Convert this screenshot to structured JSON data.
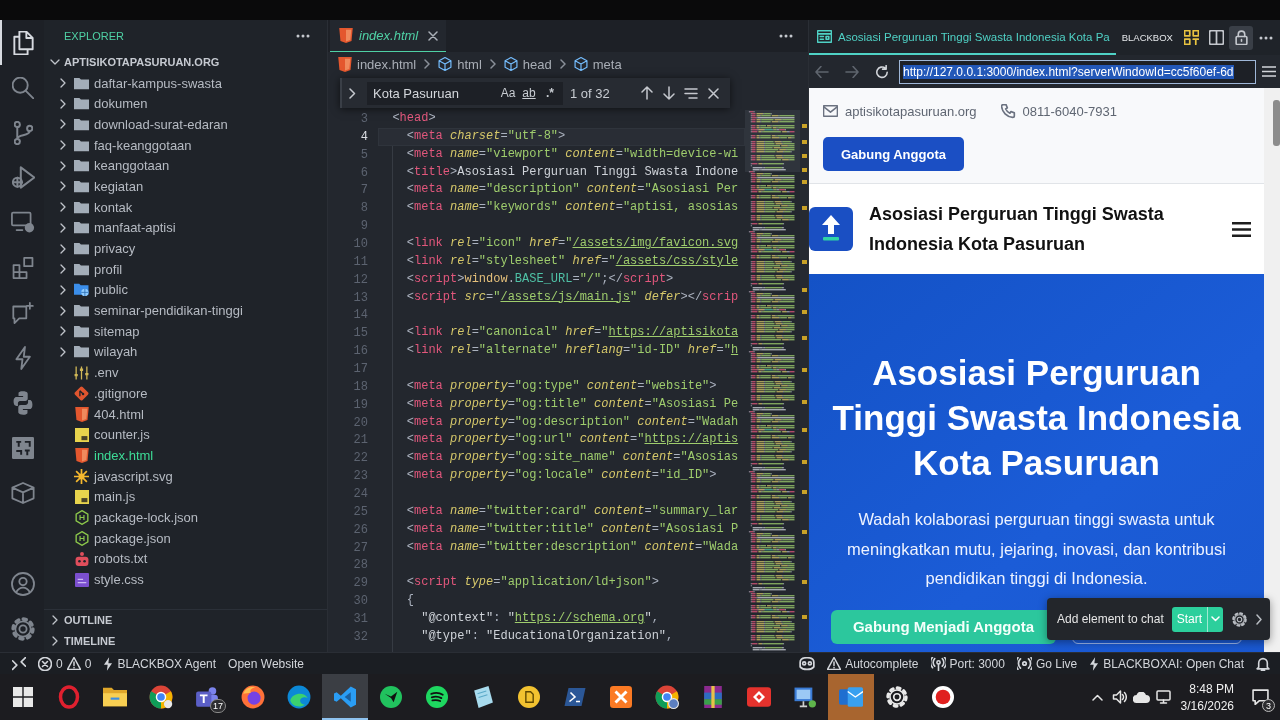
{
  "activity_bar": {
    "items": [
      {
        "kind": "explorer",
        "selected": true
      },
      {
        "kind": "search",
        "selected": false
      },
      {
        "kind": "source-control",
        "selected": false
      },
      {
        "kind": "run-debug",
        "selected": false
      },
      {
        "kind": "remote-explorer",
        "selected": false
      },
      {
        "kind": "extensions",
        "selected": false
      },
      {
        "kind": "chat",
        "selected": false
      },
      {
        "kind": "agent",
        "selected": false
      },
      {
        "kind": "python",
        "selected": false
      },
      {
        "kind": "tile",
        "selected": false
      },
      {
        "kind": "containers",
        "selected": false
      }
    ],
    "bottom": [
      {
        "kind": "accounts"
      },
      {
        "kind": "manage"
      }
    ]
  },
  "sidebar": {
    "title": "EXPLORER",
    "tree": {
      "label": "APTISIKOTAPASURUAN.ORG",
      "expanded": true,
      "children": [
        {
          "label": "daftar-kampus-swasta",
          "kind": "folder",
          "expanded": false,
          "selected": false
        },
        {
          "label": "dokumen",
          "kind": "folder",
          "expanded": false,
          "selected": false
        },
        {
          "label": "download-surat-edaran",
          "kind": "folder",
          "expanded": false,
          "selected": false
        },
        {
          "label": "faq-keanggotaan",
          "kind": "folder",
          "expanded": false,
          "selected": false
        },
        {
          "label": "keanggotaan",
          "kind": "folder",
          "expanded": false,
          "selected": false
        },
        {
          "label": "kegiatan",
          "kind": "folder",
          "expanded": false,
          "selected": false
        },
        {
          "label": "kontak",
          "kind": "folder",
          "expanded": false,
          "selected": false
        },
        {
          "label": "manfaat-aptisi",
          "kind": "folder",
          "expanded": false,
          "selected": false
        },
        {
          "label": "privacy",
          "kind": "folder",
          "expanded": false,
          "selected": false
        },
        {
          "label": "profil",
          "kind": "folder",
          "expanded": false,
          "selected": false
        },
        {
          "label": "public",
          "kind": "webfolder",
          "expanded": false,
          "selected": false
        },
        {
          "label": "seminar-pendidikan-tinggi",
          "kind": "folder",
          "expanded": false,
          "selected": false
        },
        {
          "label": "sitemap",
          "kind": "folder",
          "expanded": false,
          "selected": false
        },
        {
          "label": "wilayah",
          "kind": "folder",
          "expanded": false,
          "selected": false
        },
        {
          "label": ".env",
          "kind": "env",
          "selected": false
        },
        {
          "label": ".gitignore",
          "kind": "git",
          "selected": false
        },
        {
          "label": "404.html",
          "kind": "html",
          "selected": false
        },
        {
          "label": "counter.js",
          "kind": "js",
          "selected": false
        },
        {
          "label": "index.html",
          "kind": "html",
          "selected": true
        },
        {
          "label": "javascript.svg",
          "kind": "svg",
          "selected": false
        },
        {
          "label": "main.js",
          "kind": "js",
          "selected": false
        },
        {
          "label": "package-lock.json",
          "kind": "npm",
          "selected": false
        },
        {
          "label": "package.json",
          "kind": "npm",
          "selected": false
        },
        {
          "label": "robots.txt",
          "kind": "robot",
          "selected": false
        },
        {
          "label": "style.css",
          "kind": "css",
          "selected": false
        }
      ]
    },
    "sections": [
      {
        "label": "OUTLINE",
        "expanded": false
      },
      {
        "label": "TIMELINE",
        "expanded": false
      }
    ]
  },
  "editor": {
    "tabs": [
      {
        "label": "index.html",
        "kind": "html",
        "selected": true,
        "preview": true
      }
    ],
    "breadcrumbs": [
      {
        "label": "index.html",
        "kind": "file"
      },
      {
        "label": "html",
        "kind": "element"
      },
      {
        "label": "head",
        "kind": "element"
      },
      {
        "label": "meta",
        "kind": "element"
      }
    ],
    "find": {
      "value": "Kota Pasuruan",
      "options": [
        {
          "label": "Aa",
          "kind": "case"
        },
        {
          "label": "ab",
          "kind": "word"
        },
        {
          "label": ".*",
          "kind": "regex"
        }
      ],
      "result": "1 of 32"
    },
    "lines": [
      {
        "number": "3",
        "current": false,
        "tokens": [
          {
            "kind": "punct",
            "text": "  <"
          },
          {
            "kind": "tag",
            "text": "head"
          },
          {
            "kind": "punct",
            "text": ">"
          }
        ]
      },
      {
        "number": "4",
        "current": true,
        "tokens": [
          {
            "kind": "punct",
            "text": "    <"
          },
          {
            "kind": "tag",
            "text": "meta"
          },
          {
            "kind": "attr",
            "text": " charset"
          },
          {
            "kind": "punct",
            "text": "="
          },
          {
            "kind": "string",
            "text": "\"utf-8\""
          },
          {
            "kind": "punct",
            "text": ">"
          }
        ]
      },
      {
        "number": "5",
        "current": false,
        "tokens": [
          {
            "kind": "punct",
            "text": "    <"
          },
          {
            "kind": "tag",
            "text": "meta"
          },
          {
            "kind": "attr",
            "text": " name"
          },
          {
            "kind": "punct",
            "text": "="
          },
          {
            "kind": "string",
            "text": "\"viewport\""
          },
          {
            "kind": "attr",
            "text": " content"
          },
          {
            "kind": "punct",
            "text": "="
          },
          {
            "kind": "string",
            "text": "\"width=device-wi"
          }
        ]
      },
      {
        "number": "6",
        "current": false,
        "tokens": [
          {
            "kind": "punct",
            "text": "    <"
          },
          {
            "kind": "tag",
            "text": "title"
          },
          {
            "kind": "punct",
            "text": ">"
          },
          {
            "kind": "text",
            "text": "Asosiasi Perguruan Tinggi Swasta Indone"
          }
        ]
      },
      {
        "number": "7",
        "current": false,
        "tokens": [
          {
            "kind": "punct",
            "text": "    <"
          },
          {
            "kind": "tag",
            "text": "meta"
          },
          {
            "kind": "attr",
            "text": " name"
          },
          {
            "kind": "punct",
            "text": "="
          },
          {
            "kind": "string",
            "text": "\"description\""
          },
          {
            "kind": "attr",
            "text": " content"
          },
          {
            "kind": "punct",
            "text": "="
          },
          {
            "kind": "string",
            "text": "\"Asosiasi Per"
          }
        ]
      },
      {
        "number": "8",
        "current": false,
        "tokens": [
          {
            "kind": "punct",
            "text": "    <"
          },
          {
            "kind": "tag",
            "text": "meta"
          },
          {
            "kind": "attr",
            "text": " name"
          },
          {
            "kind": "punct",
            "text": "="
          },
          {
            "kind": "string",
            "text": "\"keywords\""
          },
          {
            "kind": "attr",
            "text": " content"
          },
          {
            "kind": "punct",
            "text": "="
          },
          {
            "kind": "string",
            "text": "\"aptisi, asosias"
          }
        ]
      },
      {
        "number": "9",
        "current": false
      },
      {
        "number": "10",
        "current": false,
        "tokens": [
          {
            "kind": "punct",
            "text": "    <"
          },
          {
            "kind": "tag",
            "text": "link"
          },
          {
            "kind": "attr",
            "text": " rel"
          },
          {
            "kind": "punct",
            "text": "="
          },
          {
            "kind": "string",
            "text": "\"icon\""
          },
          {
            "kind": "attr",
            "text": " href"
          },
          {
            "kind": "punct",
            "text": "="
          },
          {
            "kind": "string",
            "text": "\""
          },
          {
            "kind": "link",
            "text": "/assets/img/favicon.svg"
          }
        ]
      },
      {
        "number": "11",
        "current": false,
        "tokens": [
          {
            "kind": "punct",
            "text": "    <"
          },
          {
            "kind": "tag",
            "text": "link"
          },
          {
            "kind": "attr",
            "text": " rel"
          },
          {
            "kind": "punct",
            "text": "="
          },
          {
            "kind": "string",
            "text": "\"stylesheet\""
          },
          {
            "kind": "attr",
            "text": " href"
          },
          {
            "kind": "punct",
            "text": "="
          },
          {
            "kind": "string",
            "text": "\""
          },
          {
            "kind": "link",
            "text": "/assets/css/style"
          }
        ]
      },
      {
        "number": "12",
        "current": false,
        "tokens": [
          {
            "kind": "punct",
            "text": "    <"
          },
          {
            "kind": "tag",
            "text": "script"
          },
          {
            "kind": "punct",
            "text": ">"
          },
          {
            "kind": "object",
            "text": "window"
          },
          {
            "kind": "punct",
            "text": "."
          },
          {
            "kind": "property",
            "text": "BASE_URL"
          },
          {
            "kind": "punct",
            "text": "="
          },
          {
            "kind": "string",
            "text": "\"/\""
          },
          {
            "kind": "punct",
            "text": ";</"
          },
          {
            "kind": "tag",
            "text": "script"
          },
          {
            "kind": "punct",
            "text": ">"
          }
        ]
      },
      {
        "number": "13",
        "current": false,
        "tokens": [
          {
            "kind": "punct",
            "text": "    <"
          },
          {
            "kind": "tag",
            "text": "script"
          },
          {
            "kind": "attr",
            "text": " src"
          },
          {
            "kind": "punct",
            "text": "="
          },
          {
            "kind": "string",
            "text": "\""
          },
          {
            "kind": "link",
            "text": "/assets/js/main.js"
          },
          {
            "kind": "string",
            "text": "\""
          },
          {
            "kind": "attr",
            "text": " defer"
          },
          {
            "kind": "punct",
            "text": "></"
          },
          {
            "kind": "tag",
            "text": "scrip"
          }
        ]
      },
      {
        "number": "14",
        "current": false
      },
      {
        "number": "15",
        "current": false,
        "tokens": [
          {
            "kind": "punct",
            "text": "    <"
          },
          {
            "kind": "tag",
            "text": "link"
          },
          {
            "kind": "attr",
            "text": " rel"
          },
          {
            "kind": "punct",
            "text": "="
          },
          {
            "kind": "string",
            "text": "\"canonical\""
          },
          {
            "kind": "attr",
            "text": " href"
          },
          {
            "kind": "punct",
            "text": "="
          },
          {
            "kind": "string",
            "text": "\""
          },
          {
            "kind": "link",
            "text": "https://aptisikota"
          }
        ]
      },
      {
        "number": "16",
        "current": false,
        "tokens": [
          {
            "kind": "punct",
            "text": "    <"
          },
          {
            "kind": "tag",
            "text": "link"
          },
          {
            "kind": "attr",
            "text": " rel"
          },
          {
            "kind": "punct",
            "text": "="
          },
          {
            "kind": "string",
            "text": "\"alternate\""
          },
          {
            "kind": "attr",
            "text": " hreflang"
          },
          {
            "kind": "punct",
            "text": "="
          },
          {
            "kind": "string",
            "text": "\"id-ID\""
          },
          {
            "kind": "attr",
            "text": " href"
          },
          {
            "kind": "punct",
            "text": "="
          },
          {
            "kind": "string",
            "text": "\""
          },
          {
            "kind": "link",
            "text": "h"
          }
        ]
      },
      {
        "number": "17",
        "current": false
      },
      {
        "number": "18",
        "current": false,
        "tokens": [
          {
            "kind": "punct",
            "text": "    <"
          },
          {
            "kind": "tag",
            "text": "meta"
          },
          {
            "kind": "attr",
            "text": " property"
          },
          {
            "kind": "punct",
            "text": "="
          },
          {
            "kind": "string",
            "text": "\"og:type\""
          },
          {
            "kind": "attr",
            "text": " content"
          },
          {
            "kind": "punct",
            "text": "="
          },
          {
            "kind": "string",
            "text": "\"website\""
          },
          {
            "kind": "punct",
            "text": ">"
          }
        ]
      },
      {
        "number": "19",
        "current": false,
        "tokens": [
          {
            "kind": "punct",
            "text": "    <"
          },
          {
            "kind": "tag",
            "text": "meta"
          },
          {
            "kind": "attr",
            "text": " property"
          },
          {
            "kind": "punct",
            "text": "="
          },
          {
            "kind": "string",
            "text": "\"og:title\""
          },
          {
            "kind": "attr",
            "text": " content"
          },
          {
            "kind": "punct",
            "text": "="
          },
          {
            "kind": "string",
            "text": "\"Asosiasi Pe"
          }
        ]
      },
      {
        "number": "20",
        "current": false,
        "tokens": [
          {
            "kind": "punct",
            "text": "    <"
          },
          {
            "kind": "tag",
            "text": "meta"
          },
          {
            "kind": "attr",
            "text": " property"
          },
          {
            "kind": "punct",
            "text": "="
          },
          {
            "kind": "string",
            "text": "\"og:description\""
          },
          {
            "kind": "attr",
            "text": " content"
          },
          {
            "kind": "punct",
            "text": "="
          },
          {
            "kind": "string",
            "text": "\"Wadah"
          }
        ]
      },
      {
        "number": "21",
        "current": false,
        "tokens": [
          {
            "kind": "punct",
            "text": "    <"
          },
          {
            "kind": "tag",
            "text": "meta"
          },
          {
            "kind": "attr",
            "text": " property"
          },
          {
            "kind": "punct",
            "text": "="
          },
          {
            "kind": "string",
            "text": "\"og:url\""
          },
          {
            "kind": "attr",
            "text": " content"
          },
          {
            "kind": "punct",
            "text": "="
          },
          {
            "kind": "string",
            "text": "\""
          },
          {
            "kind": "link",
            "text": "https://aptis"
          }
        ]
      },
      {
        "number": "22",
        "current": false,
        "tokens": [
          {
            "kind": "punct",
            "text": "    <"
          },
          {
            "kind": "tag",
            "text": "meta"
          },
          {
            "kind": "attr",
            "text": " property"
          },
          {
            "kind": "punct",
            "text": "="
          },
          {
            "kind": "string",
            "text": "\"og:site_name\""
          },
          {
            "kind": "attr",
            "text": " content"
          },
          {
            "kind": "punct",
            "text": "="
          },
          {
            "kind": "string",
            "text": "\"Asosias"
          }
        ]
      },
      {
        "number": "23",
        "current": false,
        "tokens": [
          {
            "kind": "punct",
            "text": "    <"
          },
          {
            "kind": "tag",
            "text": "meta"
          },
          {
            "kind": "attr",
            "text": " property"
          },
          {
            "kind": "punct",
            "text": "="
          },
          {
            "kind": "string",
            "text": "\"og:locale\""
          },
          {
            "kind": "attr",
            "text": " content"
          },
          {
            "kind": "punct",
            "text": "="
          },
          {
            "kind": "string",
            "text": "\"id_ID\""
          },
          {
            "kind": "punct",
            "text": ">"
          }
        ]
      },
      {
        "number": "24",
        "current": false
      },
      {
        "number": "25",
        "current": false,
        "tokens": [
          {
            "kind": "punct",
            "text": "    <"
          },
          {
            "kind": "tag",
            "text": "meta"
          },
          {
            "kind": "attr",
            "text": " name"
          },
          {
            "kind": "punct",
            "text": "="
          },
          {
            "kind": "string",
            "text": "\"twitter:card\""
          },
          {
            "kind": "attr",
            "text": " content"
          },
          {
            "kind": "punct",
            "text": "="
          },
          {
            "kind": "string",
            "text": "\"summary_lar"
          }
        ]
      },
      {
        "number": "26",
        "current": false,
        "tokens": [
          {
            "kind": "punct",
            "text": "    <"
          },
          {
            "kind": "tag",
            "text": "meta"
          },
          {
            "kind": "attr",
            "text": " name"
          },
          {
            "kind": "punct",
            "text": "="
          },
          {
            "kind": "string",
            "text": "\"twitter:title\""
          },
          {
            "kind": "attr",
            "text": " content"
          },
          {
            "kind": "punct",
            "text": "="
          },
          {
            "kind": "string",
            "text": "\"Asosiasi P"
          }
        ]
      },
      {
        "number": "27",
        "current": false,
        "tokens": [
          {
            "kind": "punct",
            "text": "    <"
          },
          {
            "kind": "tag",
            "text": "meta"
          },
          {
            "kind": "attr",
            "text": " name"
          },
          {
            "kind": "punct",
            "text": "="
          },
          {
            "kind": "string",
            "text": "\"twitter:description\""
          },
          {
            "kind": "attr",
            "text": " content"
          },
          {
            "kind": "punct",
            "text": "="
          },
          {
            "kind": "string",
            "text": "\"Wada"
          }
        ]
      },
      {
        "number": "28",
        "current": false
      },
      {
        "number": "29",
        "current": false,
        "tokens": [
          {
            "kind": "punct",
            "text": "    <"
          },
          {
            "kind": "tag",
            "text": "script"
          },
          {
            "kind": "attr",
            "text": " type"
          },
          {
            "kind": "punct",
            "text": "="
          },
          {
            "kind": "string",
            "text": "\"application/ld+json\""
          },
          {
            "kind": "punct",
            "text": ">"
          }
        ]
      },
      {
        "number": "30",
        "current": false,
        "tokens": [
          {
            "kind": "punct",
            "text": "    {"
          }
        ]
      },
      {
        "number": "31",
        "current": false,
        "tokens": [
          {
            "kind": "text",
            "text": "      \"@context\""
          },
          {
            "kind": "punct",
            "text": ": "
          },
          {
            "kind": "text",
            "text": "\""
          },
          {
            "kind": "link",
            "text": "https://schema.org"
          },
          {
            "kind": "text",
            "text": "\""
          },
          {
            "kind": "punct",
            "text": ","
          }
        ]
      },
      {
        "number": "32",
        "current": false,
        "tokens": [
          {
            "kind": "text",
            "text": "      \"@type\""
          },
          {
            "kind": "punct",
            "text": ": "
          },
          {
            "kind": "text",
            "text": "\"EducationalOrganization\""
          },
          {
            "kind": "punct",
            "text": ","
          }
        ]
      }
    ]
  },
  "browser": {
    "tab": {
      "title": "Asosiasi Perguruan Tinggi Swasta Indonesia Kota Pa",
      "selected": true
    },
    "label": "BLACKBOX",
    "actions": [
      {
        "kind": "grid",
        "on": false
      },
      {
        "kind": "split",
        "on": false
      },
      {
        "kind": "lock",
        "on": true
      },
      {
        "kind": "more",
        "on": false
      }
    ],
    "nav": [
      {
        "kind": "back",
        "disabled": true
      },
      {
        "kind": "forward",
        "disabled": true
      },
      {
        "kind": "reload",
        "disabled": false
      }
    ],
    "url": {
      "value": "http://127.0.0.1:3000/index.html?serverWindowId=cc5f60ef-6d",
      "selected": true
    },
    "page": {
      "contacts": [
        {
          "kind": "email",
          "text": "aptisikotapasuruan.org"
        },
        {
          "kind": "phone",
          "text": "0811-6040-7931"
        }
      ],
      "join_button": "Gabung Anggota",
      "brand": "Asosiasi Perguruan Tinggi Swasta Indonesia Kota Pasuruan",
      "hero": {
        "title": "Asosiasi Perguruan Tinggi Swasta Indonesia Kota Pasuruan",
        "text": "Wadah kolaborasi perguruan tinggi swasta untuk meningkatkan mutu, jejaring, inovasi, dan kontribusi pendidikan tinggi di Indonesia.",
        "buttons": [
          {
            "kind": "primary",
            "label": "Gabung Menjadi Anggota"
          },
          {
            "kind": "outline"
          }
        ]
      }
    },
    "chat_popup": {
      "label": "Add element to chat",
      "button": "Start"
    }
  },
  "status_bar": {
    "left": [
      {
        "kind": "window"
      },
      {
        "kind": "problems",
        "errors": "0",
        "warnings": "0"
      },
      {
        "kind": "agent",
        "label": "BLACKBOX Agent"
      },
      {
        "kind": "website",
        "label": "Open Website"
      }
    ],
    "right": [
      {
        "kind": "assistant"
      },
      {
        "kind": "autocomplete",
        "label": "Autocomplete"
      },
      {
        "kind": "port",
        "label": "Port: 3000"
      },
      {
        "kind": "live",
        "label": "Go Live"
      },
      {
        "kind": "chat",
        "label": "BLACKBOXAI: Open Chat"
      },
      {
        "kind": "notifications"
      }
    ]
  },
  "taskbar": {
    "apps": [
      {
        "kind": "start",
        "selected": false,
        "attention": false
      },
      {
        "kind": "ring",
        "selected": false,
        "attention": false
      },
      {
        "kind": "folder",
        "selected": false,
        "attention": false
      },
      {
        "kind": "chrome",
        "selected": false,
        "attention": false
      },
      {
        "kind": "team",
        "selected": false,
        "attention": false,
        "badge": "17"
      },
      {
        "kind": "fox",
        "selected": false,
        "attention": false
      },
      {
        "kind": "wave",
        "selected": false,
        "attention": false
      },
      {
        "kind": "code",
        "selected": true,
        "attention": false
      },
      {
        "kind": "bird",
        "selected": false,
        "attention": false
      },
      {
        "kind": "music",
        "selected": false,
        "attention": false
      },
      {
        "kind": "notes",
        "selected": false,
        "attention": false
      },
      {
        "kind": "doc",
        "selected": false,
        "attention": false
      },
      {
        "kind": "terminal",
        "selected": false,
        "attention": false
      },
      {
        "kind": "cross",
        "selected": false,
        "attention": false
      },
      {
        "kind": "chrome-profile",
        "selected": false,
        "attention": false
      },
      {
        "kind": "archive",
        "selected": false,
        "attention": false
      },
      {
        "kind": "remote",
        "selected": false,
        "attention": false
      },
      {
        "kind": "monitor",
        "selected": false,
        "attention": false
      },
      {
        "kind": "mail",
        "selected": false,
        "attention": true
      },
      {
        "kind": "gear",
        "selected": false,
        "attention": false
      },
      {
        "kind": "record",
        "selected": false,
        "attention": false
      }
    ],
    "tray": {
      "time": "8:48 PM",
      "date": "3/16/2026",
      "notifications": "3"
    }
  }
}
